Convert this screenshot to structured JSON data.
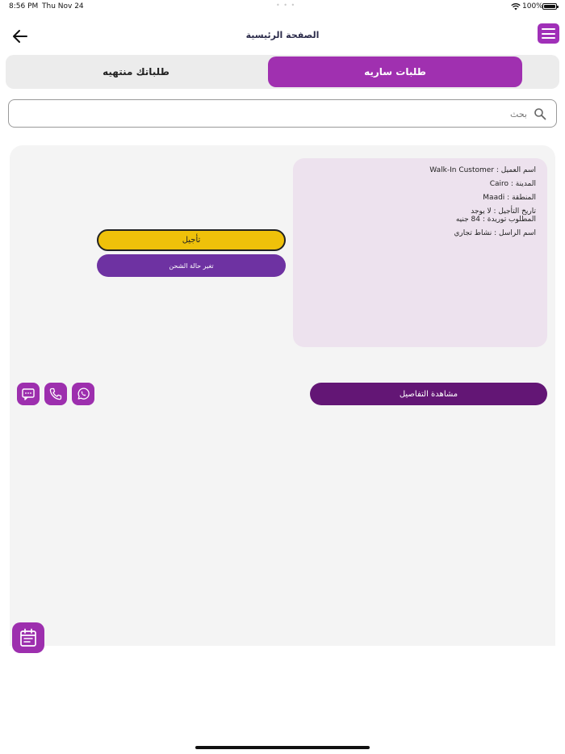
{
  "status_bar": {
    "time": "8:56 PM",
    "date": "Thu Nov 24",
    "battery": "100%"
  },
  "nav": {
    "title": "الصفحة الرئيسية",
    "back_icon": "arrow-left-icon",
    "menu_icon": "hamburger-menu-icon"
  },
  "tabs": {
    "active_label": "طلبات ساريه",
    "inactive_label": "طلباتك منتهيه"
  },
  "search": {
    "placeholder": "بحث",
    "value": ""
  },
  "order": {
    "customer_line": "اسم العميل : Walk-In Customer",
    "city_line": "المدينة : Cairo",
    "area_line": "المنطقة : Maadi",
    "postpone_date_line": "تاريخ التأجيل : لا يوجد",
    "amount_line": "المطلوب توريدة : 84 جنيه",
    "sender_line": "اسم الراسل : نشاط تجاري"
  },
  "actions": {
    "postpone_label": "تأجيل",
    "change_status_label": "تغير حالة الشحن",
    "view_details_label": "مشاهدة التفاصيل"
  },
  "colors": {
    "accent": "#a030b0",
    "dark_purple": "#631675",
    "status_purple": "#6e32a2",
    "postpone_yellow": "#efc10a",
    "card_bg": "#ede2ee",
    "panel_bg": "#f4f4f4"
  },
  "icons": [
    "whatsapp-icon",
    "phone-icon",
    "message-icon",
    "calendar-icon",
    "search-icon",
    "wifi-icon",
    "battery-icon"
  ]
}
